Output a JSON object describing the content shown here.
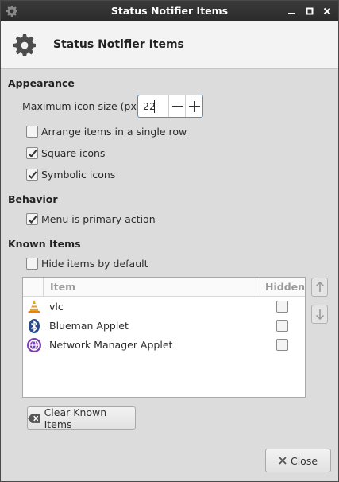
{
  "window": {
    "title": "Status Notifier Items",
    "controls": {
      "minimize": "▁",
      "maximize": "□",
      "close": "✕"
    }
  },
  "header": {
    "title": "Status Notifier Items",
    "icon": "gear-icon"
  },
  "appearance": {
    "heading": "Appearance",
    "max_icon_size_label": "Maximum icon size (px):",
    "max_icon_size_value": "22",
    "single_row": {
      "label": "Arrange items in a single row",
      "checked": false
    },
    "square_icons": {
      "label": "Square icons",
      "checked": true
    },
    "symbolic_icons": {
      "label": "Symbolic icons",
      "checked": true
    }
  },
  "behavior": {
    "heading": "Behavior",
    "menu_primary": {
      "label": "Menu is primary action",
      "checked": true
    }
  },
  "known_items": {
    "heading": "Known Items",
    "hide_by_default": {
      "label": "Hide items by default",
      "checked": false
    },
    "columns": {
      "item": "Item",
      "hidden": "Hidden"
    },
    "rows": [
      {
        "name": "vlc",
        "icon": "vlc-icon",
        "hidden": false
      },
      {
        "name": "Blueman Applet",
        "icon": "bluetooth-icon",
        "hidden": false
      },
      {
        "name": "Network Manager Applet",
        "icon": "network-manager-icon",
        "hidden": false
      }
    ],
    "clear_label": "Clear Known Items"
  },
  "footer": {
    "close_label": "Close"
  }
}
